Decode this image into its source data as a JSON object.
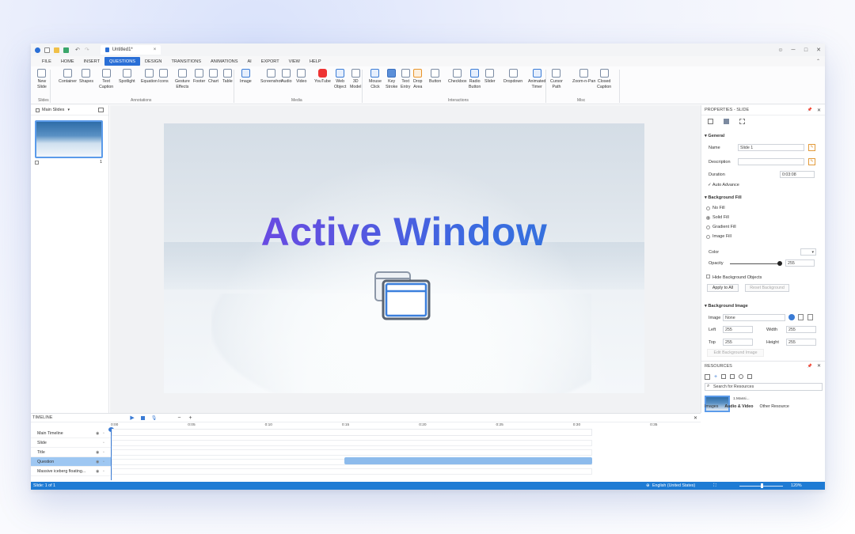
{
  "window": {
    "doc_tab": "Untitled1*",
    "close": "×",
    "minimize": "─",
    "maximize": "□",
    "win_close": "✕"
  },
  "menu": [
    "FILE",
    "HOME",
    "INSERT",
    "QUESTIONS",
    "DESIGN",
    "TRANSITIONS",
    "ANIMATIONS",
    "AI",
    "EXPORT",
    "VIEW",
    "HELP"
  ],
  "menu_active": "QUESTIONS",
  "ribbon": {
    "items": [
      {
        "label": "New\nSlide",
        "icon": "new-slide-icon"
      },
      {
        "label": "Container",
        "icon": "container-icon"
      },
      {
        "label": "Shapes",
        "icon": "shapes-icon"
      },
      {
        "label": "Text\nCaption",
        "icon": "text-caption-icon"
      },
      {
        "label": "Spotlight",
        "icon": "spotlight-icon"
      },
      {
        "label": "Equation",
        "icon": "equation-icon"
      },
      {
        "label": "Icons",
        "icon": "icons-icon"
      },
      {
        "label": "Gesture\nEffects",
        "icon": "gesture-icon"
      },
      {
        "label": "Footer",
        "icon": "footer-icon"
      },
      {
        "label": "Chart",
        "icon": "chart-icon"
      },
      {
        "label": "Table",
        "icon": "table-icon"
      },
      {
        "label": "Image",
        "icon": "image-icon"
      },
      {
        "label": "Screenshot",
        "icon": "screenshot-icon"
      },
      {
        "label": "Audio",
        "icon": "audio-icon"
      },
      {
        "label": "Video",
        "icon": "video-icon"
      },
      {
        "label": "YouTube",
        "icon": "youtube-icon"
      },
      {
        "label": "Web\nObject",
        "icon": "web-object-icon"
      },
      {
        "label": "3D\nModel",
        "icon": "3d-model-icon"
      },
      {
        "label": "Mouse\nClick",
        "icon": "mouse-click-icon"
      },
      {
        "label": "Key\nStroke",
        "icon": "key-stroke-icon"
      },
      {
        "label": "Text\nEntry",
        "icon": "text-entry-icon"
      },
      {
        "label": "Drop\nArea",
        "icon": "drop-area-icon"
      },
      {
        "label": "Button",
        "icon": "button-icon"
      },
      {
        "label": "Checkbox",
        "icon": "checkbox-icon"
      },
      {
        "label": "Radio\nButton",
        "icon": "radio-button-icon"
      },
      {
        "label": "Slider",
        "icon": "slider-icon"
      },
      {
        "label": "Dropdown",
        "icon": "dropdown-icon"
      },
      {
        "label": "Animated\nTimer",
        "icon": "animated-timer-icon"
      },
      {
        "label": "Cursor\nPath",
        "icon": "cursor-path-icon"
      },
      {
        "label": "Zoom-n-Pan",
        "icon": "zoom-n-pan-icon"
      },
      {
        "label": "Closed\nCaption",
        "icon": "closed-caption-icon"
      }
    ],
    "groups": [
      "Slides",
      "Annotations",
      "Media",
      "Interactions",
      "Misc"
    ]
  },
  "left_panel": {
    "title": "Main Slides",
    "slide_number": "1"
  },
  "slide": {
    "title": "Active Window"
  },
  "properties": {
    "title": "PROPERTIES - SLIDE",
    "general": "General",
    "name_label": "Name",
    "name_value": "Slide 1",
    "description_label": "Description",
    "duration_label": "Duration",
    "duration_value": "0:03:08",
    "auto_advance": "Auto Advance",
    "bg_fill": "Background Fill",
    "fill_options": [
      "No Fill",
      "Solid Fill",
      "Gradient Fill",
      "Image Fill"
    ],
    "fill_selected": "Solid Fill",
    "color_label": "Color",
    "opacity_label": "Opacity",
    "opacity_value": "255",
    "hide_bg": "Hide Background Objects",
    "apply_all": "Apply to All",
    "reset_bg": "Reset Background",
    "bg_image": "Background Image",
    "image_label": "Image",
    "image_value": "None",
    "left_label": "Left",
    "left_value": "255",
    "width_label": "Width",
    "width_value": "255",
    "top_label": "Top",
    "top_value": "255",
    "height_label": "Height",
    "height_value": "255",
    "edit_bg": "Edit Background Image"
  },
  "resources": {
    "title": "RESOURCES",
    "search_placeholder": "Search for Resources",
    "item_label": "1.Massi...",
    "tabs": [
      "Images",
      "Audio & Video",
      "Other Resource"
    ]
  },
  "timeline": {
    "title": "TIMELINE",
    "ticks": [
      "0:00",
      "0:05",
      "0:10",
      "0:15",
      "0:20",
      "0:25",
      "0:30",
      "0:35"
    ],
    "rows": [
      "Main Timeline",
      "Slide",
      "Title",
      "Question",
      "Massive iceberg floating..."
    ],
    "selected_row": "Question"
  },
  "status": {
    "left": "Slide: 1 of 1",
    "language": "English (United States)",
    "zoom": "120%"
  },
  "colors": {
    "accent": "#2a6fd6",
    "status": "#1e7bd4",
    "title_start": "#7b3fe4",
    "title_end": "#2f79dc"
  }
}
